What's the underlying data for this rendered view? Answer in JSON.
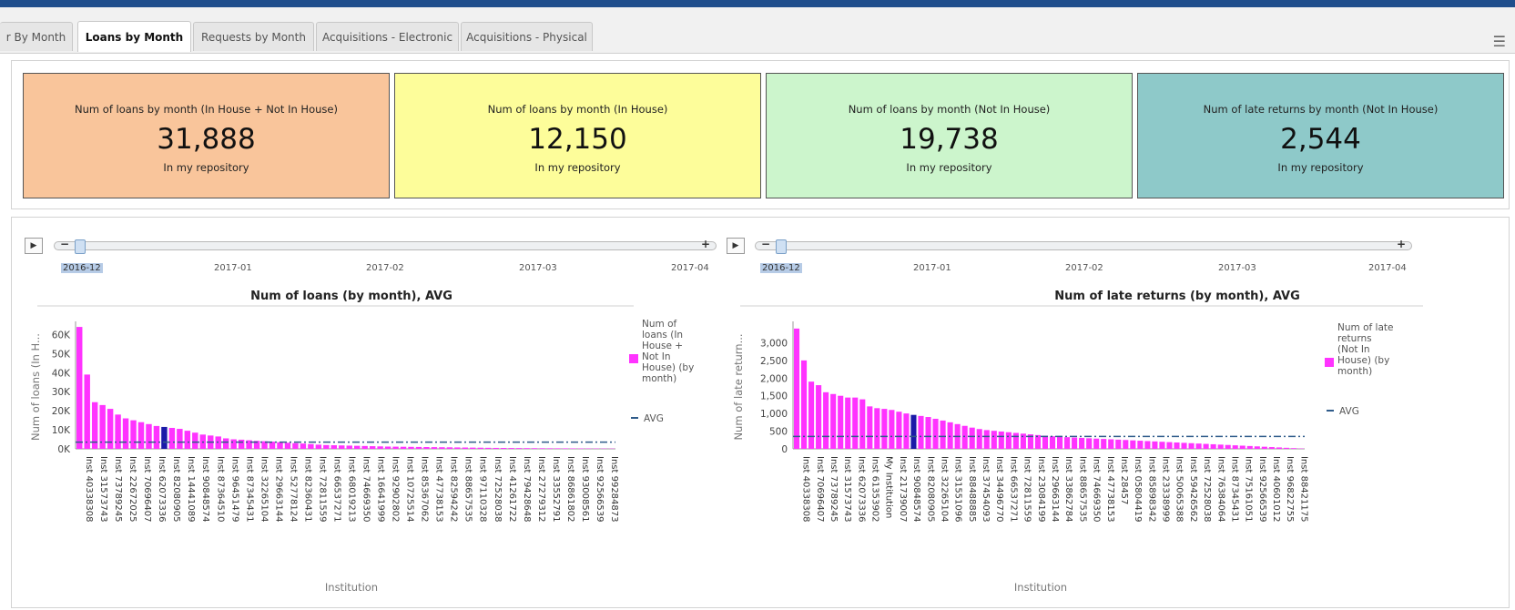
{
  "tabs": [
    {
      "label": "r By Month",
      "active": false
    },
    {
      "label": "Loans by Month",
      "active": true
    },
    {
      "label": "Requests by Month",
      "active": false
    },
    {
      "label": "Acquisitions - Electronic",
      "active": false
    },
    {
      "label": "Acquisitions - Physical",
      "active": false
    }
  ],
  "kpis": [
    {
      "title": "Num of loans by month (In House + Not In House)",
      "value": "31,888",
      "subtitle": "In my repository",
      "color": "#f9c59b"
    },
    {
      "title": "Num of loans by month (In House)",
      "value": "12,150",
      "subtitle": "In my repository",
      "color": "#fdfd9a"
    },
    {
      "title": "Num of loans by month (Not In House)",
      "value": "19,738",
      "subtitle": "In my repository",
      "color": "#ccf5cc"
    },
    {
      "title": "Num of late returns by month (Not In House)",
      "value": "2,544",
      "subtitle": "In my repository",
      "color": "#8ec9c9"
    }
  ],
  "timeline": {
    "labels": [
      "2016-12",
      "2017-01",
      "2017-02",
      "2017-03",
      "2017-04"
    ],
    "selected": "2016-12"
  },
  "colors": {
    "bar": "#ff33ff",
    "highlight": "#1a1aa8",
    "avg": "#2f5b8a"
  },
  "chart_data": [
    {
      "type": "bar",
      "title": "Num of loans (by month), AVG",
      "xlabel": "Institution",
      "ylabel": "Num of loans (In H...",
      "ylim": [
        0,
        65000
      ],
      "yticks": [
        "0K",
        "10K",
        "20K",
        "30K",
        "40K",
        "50K",
        "60K"
      ],
      "ytick_values": [
        0,
        10000,
        20000,
        30000,
        40000,
        50000,
        60000
      ],
      "avg": 3500,
      "highlight_index": 11,
      "legend": {
        "series_name": "Num of loans (In House + Not In House) (by month)",
        "series_lines": [
          "Num of",
          "loans (In",
          "House +",
          "Not In",
          "House) (by",
          "month)"
        ],
        "avg_label": "AVG"
      },
      "values": [
        64000,
        39000,
        24500,
        23000,
        21000,
        18000,
        16000,
        15000,
        14000,
        13000,
        12000,
        11500,
        11000,
        10500,
        9500,
        8500,
        7500,
        7000,
        6500,
        5500,
        5000,
        4800,
        4500,
        4200,
        4000,
        3800,
        3500,
        3200,
        3000,
        2800,
        2500,
        2200,
        2000,
        1900,
        1800,
        1700,
        1600,
        1500,
        1400,
        1300,
        1200,
        1150,
        1100,
        1050,
        1000,
        950,
        900,
        850,
        800,
        750,
        700,
        650,
        600,
        550,
        500,
        470,
        440,
        410,
        380,
        350,
        320,
        300,
        280,
        260,
        240,
        220,
        200,
        180,
        160,
        140
      ],
      "category_labels": [
        "Inst 40338308",
        "Inst 31573743",
        "Inst 73789245",
        "Inst 22672025",
        "Inst 70696407",
        "Inst 62073336",
        "Inst 82080905",
        "Inst 14441089",
        "Inst 90848574",
        "Inst 87364510",
        "Inst 96451479",
        "Inst 87345431",
        "Inst 32265104",
        "Inst 29663144",
        "Inst 52778124",
        "Inst 82360431",
        "Inst 72811559",
        "Inst 66537271",
        "Inst 68019213",
        "Inst 74669350",
        "Inst 16641999",
        "Inst 92902802",
        "Inst 10725514",
        "Inst 85367062",
        "Inst 47738153",
        "Inst 82594242",
        "Inst 88657535",
        "Inst 97110328",
        "Inst 72528038",
        "Inst 41261722",
        "Inst 79428648",
        "Inst 27279312",
        "Inst 33552791",
        "Inst 86861802",
        "Inst 93008561",
        "Inst 92566539",
        "Inst 99284873"
      ]
    },
    {
      "type": "bar",
      "title": "Num of late returns (by month), AVG",
      "xlabel": "Institution",
      "ylabel": "Num of late return...",
      "ylim": [
        0,
        3500
      ],
      "yticks": [
        "0",
        "500",
        "1,000",
        "1,500",
        "2,000",
        "2,500",
        "3,000"
      ],
      "ytick_values": [
        0,
        500,
        1000,
        1500,
        2000,
        2500,
        3000
      ],
      "avg": 350,
      "highlight_index": 16,
      "legend": {
        "series_name": "Num of late returns (Not In House) (by month)",
        "series_lines": [
          "Num of late",
          "returns",
          "(Not In",
          "House) (by",
          "month)"
        ],
        "avg_label": "AVG"
      },
      "values": [
        3400,
        2500,
        1900,
        1800,
        1600,
        1550,
        1500,
        1450,
        1450,
        1400,
        1200,
        1150,
        1130,
        1100,
        1050,
        1000,
        960,
        930,
        900,
        850,
        800,
        750,
        700,
        650,
        600,
        560,
        530,
        510,
        490,
        470,
        450,
        430,
        410,
        390,
        370,
        355,
        340,
        330,
        320,
        310,
        300,
        290,
        280,
        270,
        260,
        250,
        240,
        230,
        220,
        210,
        200,
        190,
        180,
        170,
        160,
        150,
        140,
        130,
        120,
        110,
        100,
        90,
        80,
        70,
        60,
        50,
        40,
        30,
        20,
        10
      ],
      "category_labels": [
        "Inst 40338308",
        "Inst 70696407",
        "Inst 73789245",
        "Inst 31573743",
        "Inst 62073336",
        "Inst 61353902",
        "My Institution",
        "Inst 21739007",
        "Inst 90848574",
        "Inst 82080905",
        "Inst 32265104",
        "Inst 31551096",
        "Inst 88488885",
        "Inst 37454093",
        "Inst 34496770",
        "Inst 66537271",
        "Inst 72811559",
        "Inst 23084199",
        "Inst 29663144",
        "Inst 33862784",
        "Inst 88657535",
        "Inst 74669350",
        "Inst 47738153",
        "Inst 28457",
        "Inst 05804419",
        "Inst 85898342",
        "Inst 23338999",
        "Inst 50065388",
        "Inst 59426562",
        "Inst 72528038",
        "Inst 76384064",
        "Inst 87345431",
        "Inst 75161051",
        "Inst 92566539",
        "Inst 40601012",
        "Inst 96822755",
        "Inst 88421175"
      ]
    }
  ]
}
